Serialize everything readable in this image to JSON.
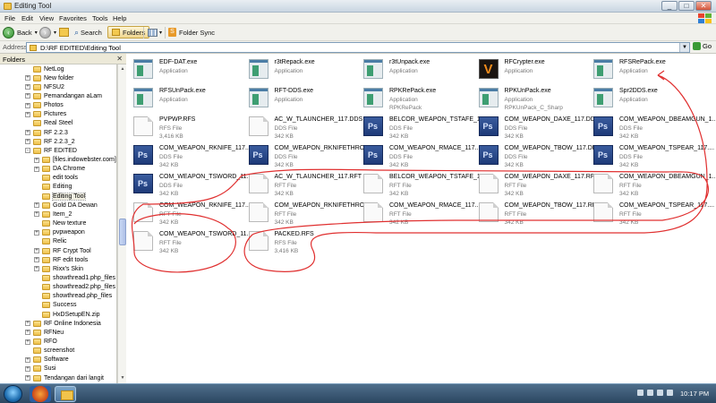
{
  "window": {
    "title": "Editing Tool"
  },
  "menu": [
    "File",
    "Edit",
    "View",
    "Favorites",
    "Tools",
    "Help"
  ],
  "toolbar": {
    "back": "Back",
    "search": "Search",
    "folders": "Folders",
    "folder_sync": "Folder Sync"
  },
  "address": {
    "label": "Address",
    "path": "D:\\RF EDITED\\Editing Tool",
    "go": "Go"
  },
  "folders_pane": {
    "title": "Folders",
    "items": [
      {
        "label": "NetLog",
        "expander": ""
      },
      {
        "label": "New folder",
        "expander": "+"
      },
      {
        "label": "NFSU2",
        "expander": "+"
      },
      {
        "label": "Pemandangan aLam",
        "expander": "+"
      },
      {
        "label": "Photos",
        "expander": "+"
      },
      {
        "label": "Pictures",
        "expander": "+"
      },
      {
        "label": "Real Steel",
        "expander": ""
      },
      {
        "label": "RF 2.2.3",
        "expander": "+"
      },
      {
        "label": "RF 2.2.3_2",
        "expander": "+"
      },
      {
        "label": "RF EDITED",
        "expander": "-"
      },
      {
        "label": "[files.indowebster.com]-C",
        "expander": "+"
      },
      {
        "label": "DA Chrome",
        "expander": "+"
      },
      {
        "label": "edit tools",
        "expander": ""
      },
      {
        "label": "Editing",
        "expander": ""
      },
      {
        "label": "Editing Tool",
        "expander": ""
      },
      {
        "label": "Gold DA Dewan",
        "expander": "+"
      },
      {
        "label": "Item_2",
        "expander": "+"
      },
      {
        "label": "New texture",
        "expander": ""
      },
      {
        "label": "pvpweapon",
        "expander": "+"
      },
      {
        "label": "Relic",
        "expander": ""
      },
      {
        "label": "RF Crypt Tool",
        "expander": "+"
      },
      {
        "label": "RF edit tools",
        "expander": "+"
      },
      {
        "label": "Rixx's Skin",
        "expander": "+"
      },
      {
        "label": "showthread1.php_files",
        "expander": ""
      },
      {
        "label": "showthread2.php_files",
        "expander": ""
      },
      {
        "label": "showthread.php_files",
        "expander": ""
      },
      {
        "label": "Success",
        "expander": ""
      },
      {
        "label": "HxDSetupEN.zip",
        "expander": ""
      },
      {
        "label": "RF Online Indonesia",
        "expander": "+"
      },
      {
        "label": "RFNeu",
        "expander": "+"
      },
      {
        "label": "RFO",
        "expander": "+"
      },
      {
        "label": "screenshot",
        "expander": ""
      },
      {
        "label": "Software",
        "expander": "+"
      },
      {
        "label": "Susi",
        "expander": "+"
      },
      {
        "label": "Tendangan dari langit",
        "expander": "+"
      }
    ]
  },
  "files": [
    {
      "name": "EDF-DAT.exe",
      "type": "Application",
      "size": "",
      "icon": "app-icon"
    },
    {
      "name": "r3tRepack.exe",
      "type": "Application",
      "size": "",
      "icon": "app-icon"
    },
    {
      "name": "r3tUnpack.exe",
      "type": "Application",
      "size": "",
      "icon": "app-icon"
    },
    {
      "name": "RFCrypter.exe",
      "type": "Application",
      "size": "",
      "icon": "rfcrypter-icon"
    },
    {
      "name": "RFSRePack.exe",
      "type": "Application",
      "size": "",
      "icon": "app-icon"
    },
    {
      "name": "RFSUnPack.exe",
      "type": "Application",
      "size": "",
      "icon": "app-icon"
    },
    {
      "name": "RFT-DDS.exe",
      "type": "Application",
      "size": "",
      "icon": "app-icon"
    },
    {
      "name": "RPKRePack.exe",
      "type": "Application",
      "size": "RPKRePack",
      "icon": "app-icon"
    },
    {
      "name": "RPKUnPack.exe",
      "type": "Application",
      "size": "RPKUnPack_C_Sharp",
      "icon": "app-icon"
    },
    {
      "name": "Spr2DDS.exe",
      "type": "Application",
      "size": "",
      "icon": "app-icon"
    },
    {
      "name": "PVPWP.RFS",
      "type": "RFS File",
      "size": "3,416 KB",
      "icon": "doc-icon"
    },
    {
      "name": "AC_W_TLAUNCHER_117.DDS",
      "type": "DDS File",
      "size": "342 KB",
      "icon": "doc-icon"
    },
    {
      "name": "BELCOR_WEAPON_TSTAFE_1...",
      "type": "DDS File",
      "size": "342 KB",
      "icon": "ps-icon"
    },
    {
      "name": "COM_WEAPON_DAXE_117.DDS",
      "type": "DDS File",
      "size": "342 KB",
      "icon": "ps-icon"
    },
    {
      "name": "COM_WEAPON_DBEAMGUN_1...",
      "type": "DDS File",
      "size": "342 KB",
      "icon": "ps-icon"
    },
    {
      "name": "COM_WEAPON_RKNIFE_117....",
      "type": "DDS File",
      "size": "342 KB",
      "icon": "ps-icon"
    },
    {
      "name": "COM_WEAPON_RKNIFETHRO...",
      "type": "DDS File",
      "size": "342 KB",
      "icon": "ps-icon"
    },
    {
      "name": "COM_WEAPON_RMACE_117....",
      "type": "DDS File",
      "size": "342 KB",
      "icon": "ps-icon"
    },
    {
      "name": "COM_WEAPON_TBOW_117.DDS",
      "type": "DDS File",
      "size": "342 KB",
      "icon": "ps-icon"
    },
    {
      "name": "COM_WEAPON_TSPEAR_117....",
      "type": "DDS File",
      "size": "342 KB",
      "icon": "ps-icon"
    },
    {
      "name": "COM_WEAPON_TSWORD_11...",
      "type": "DDS File",
      "size": "342 KB",
      "icon": "ps-icon"
    },
    {
      "name": "AC_W_TLAUNCHER_117.RFT",
      "type": "RFT File",
      "size": "342 KB",
      "icon": "doc-icon"
    },
    {
      "name": "BELCOR_WEAPON_TSTAFE_1...",
      "type": "RFT File",
      "size": "342 KB",
      "icon": "doc-icon"
    },
    {
      "name": "COM_WEAPON_DAXE_117.RFT",
      "type": "RFT File",
      "size": "342 KB",
      "icon": "doc-icon"
    },
    {
      "name": "COM_WEAPON_DBEAMGUN_1...",
      "type": "RFT File",
      "size": "342 KB",
      "icon": "doc-icon"
    },
    {
      "name": "COM_WEAPON_RKNIFE_117....",
      "type": "RFT File",
      "size": "342 KB",
      "icon": "doc-icon"
    },
    {
      "name": "COM_WEAPON_RKNIFETHRO...",
      "type": "RFT File",
      "size": "342 KB",
      "icon": "doc-icon"
    },
    {
      "name": "COM_WEAPON_RMACE_117....",
      "type": "RFT File",
      "size": "342 KB",
      "icon": "doc-icon"
    },
    {
      "name": "COM_WEAPON_TBOW_117.RFT",
      "type": "RFT File",
      "size": "342 KB",
      "icon": "doc-icon"
    },
    {
      "name": "COM_WEAPON_TSPEAR_117....",
      "type": "RFT File",
      "size": "342 KB",
      "icon": "doc-icon"
    },
    {
      "name": "COM_WEAPON_TSWORD_11...",
      "type": "RFT File",
      "size": "342 KB",
      "icon": "doc-icon"
    },
    {
      "name": "PACKED.RFS",
      "type": "RFS File",
      "size": "3,416 KB",
      "icon": "doc-icon"
    }
  ],
  "taskbar": {
    "clock": "10:17 PM"
  },
  "colors": {
    "annotation": "#e03030",
    "selection": "#316ac5"
  }
}
